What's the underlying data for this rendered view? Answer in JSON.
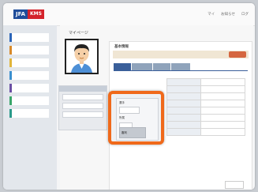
{
  "app": {
    "logo_primary": "JFA",
    "logo_secondary": "KMS"
  },
  "header": {
    "nav": [
      "マイ",
      "お知らせ",
      "ログ"
    ]
  },
  "page": {
    "title": "マイページ"
  },
  "sidebar": {
    "items": [
      "",
      "",
      "",
      "",
      "",
      "",
      ""
    ]
  },
  "card": {
    "title": "基本情報",
    "tabs": [
      "",
      "",
      "",
      "",
      ""
    ]
  },
  "popup": {
    "line1": "選手",
    "line2": "所属",
    "chip": "審判"
  },
  "colors": {
    "highlight": "#f0691a",
    "brand_blue": "#1f4d9a",
    "brand_red": "#d4232b"
  }
}
